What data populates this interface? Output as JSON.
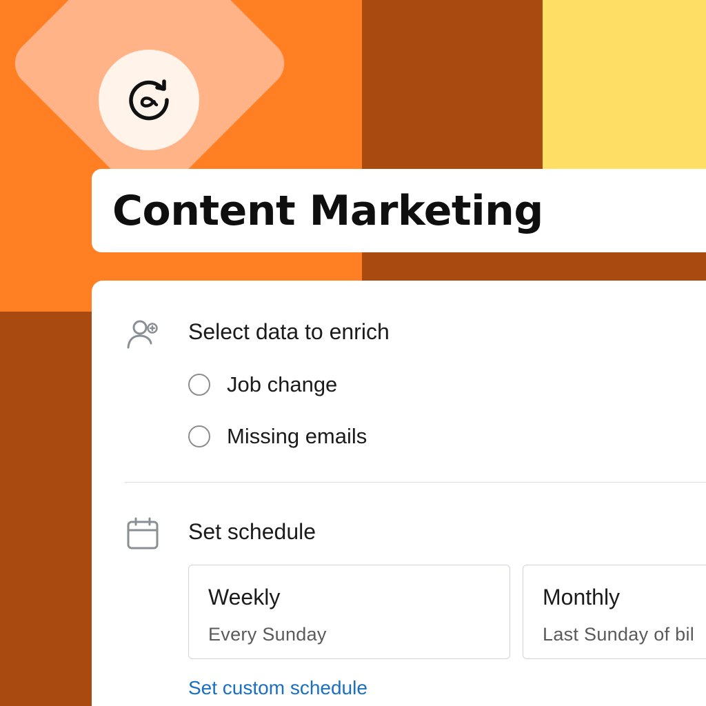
{
  "header": {
    "title": "Content Marketing"
  },
  "enrich": {
    "title": "Select data to enrich",
    "options": [
      {
        "label": "Job change",
        "selected": false
      },
      {
        "label": "Missing emails",
        "selected": false
      }
    ]
  },
  "schedule": {
    "title": "Set schedule",
    "cards": [
      {
        "title": "Weekly",
        "subtitle": "Every Sunday"
      },
      {
        "title": "Monthly",
        "subtitle": "Last Sunday of bil"
      }
    ],
    "custom_link": "Set custom schedule"
  },
  "icons": {
    "logo": "refresh-at-icon",
    "enrich": "user-plus-icon",
    "schedule": "calendar-icon"
  },
  "colors": {
    "orange": "#ff7f22",
    "brown": "#a94b10",
    "yellow": "#ffde66",
    "diamond": "#ffb386",
    "link": "#1a6fc2"
  }
}
